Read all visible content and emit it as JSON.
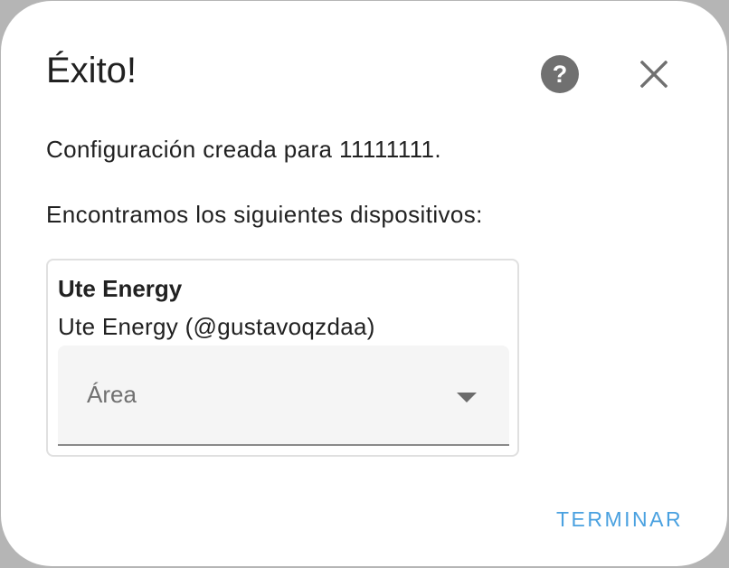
{
  "dialog": {
    "title": "Éxito!",
    "message_created": "Configuración creada para 11111111.",
    "message_devices": "Encontramos los siguientes dispositivos:",
    "help_icon": "help-circle-icon",
    "close_icon": "close-icon"
  },
  "device": {
    "name": "Ute Energy",
    "subtitle": "Ute Energy (@gustavoqzdaa)",
    "area_placeholder": "Área",
    "area_value": ""
  },
  "actions": {
    "finish_label": "TERMINAR"
  },
  "colors": {
    "accent": "#4aa1e0",
    "text": "#212121",
    "icon": "#707070",
    "field_bg": "#f5f5f5"
  }
}
